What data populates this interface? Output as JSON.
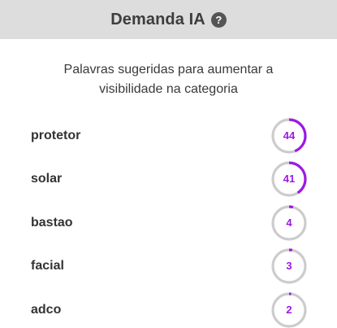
{
  "header": {
    "title": "Demanda IA",
    "help_icon": "question-circle-icon",
    "help_symbol": "?"
  },
  "subtitle": "Palavras sugeridas para aumentar a visibilidade na categoria",
  "colors": {
    "accent": "#9b19e6",
    "track": "#cccccc",
    "header_bg": "#dddddd"
  },
  "keywords": [
    {
      "label": "protetor",
      "value": "44",
      "progress": 0.44
    },
    {
      "label": "solar",
      "value": "41",
      "progress": 0.41
    },
    {
      "label": "bastao",
      "value": "4",
      "progress": 0.04
    },
    {
      "label": "facial",
      "value": "3",
      "progress": 0.03
    },
    {
      "label": "adco",
      "value": "2",
      "progress": 0.02
    }
  ]
}
